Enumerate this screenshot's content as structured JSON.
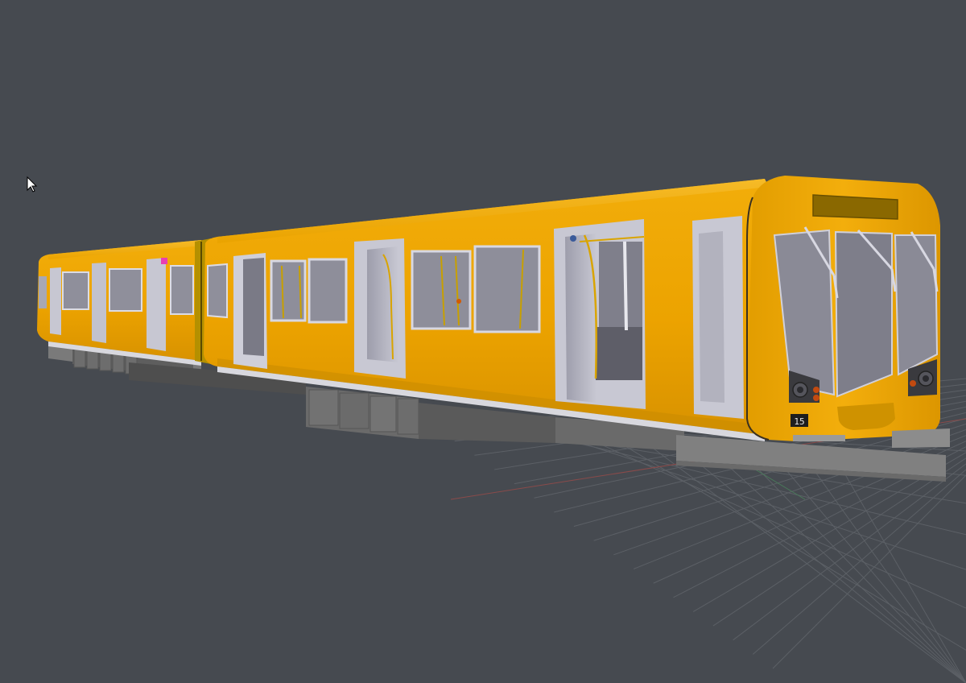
{
  "viewport": {
    "background_color": "#464a50",
    "grid_color": "#5c6066",
    "x_axis_color": "#8a4a4a",
    "y_axis_color": "#4a7a5a"
  },
  "train": {
    "body_color": "#f0a800",
    "body_shadow_color": "#c98c00",
    "interior_color": "#b9b9c6",
    "underframe_color": "#6a6a6a",
    "front_unit_number": "15"
  },
  "cursor": {
    "icon": "arrow-cursor-icon"
  }
}
